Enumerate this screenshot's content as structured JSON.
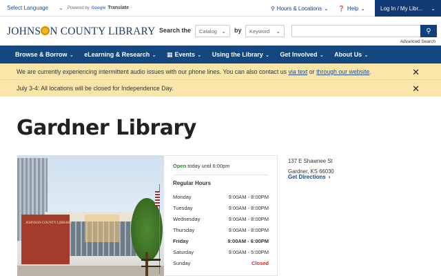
{
  "util": {
    "language_label": "Select Language",
    "powered_by": "Powered by",
    "google": "Google",
    "translate": "Translate",
    "hours_locations": "Hours & Locations",
    "help": "Help",
    "login": "Log In / My Libr..."
  },
  "header": {
    "logo_left": "JOHNS",
    "logo_right": "N COUNTY LIBRARY",
    "search_label": "Search the",
    "catalog_select": "Catalog",
    "by_label": "by",
    "keyword_select": "Keyword",
    "search_value": "",
    "advanced_search": "Advanced Search"
  },
  "nav": {
    "items": [
      {
        "label": "Browse & Borrow"
      },
      {
        "label": "eLearning & Research"
      },
      {
        "label": "Events"
      },
      {
        "label": "Using the Library"
      },
      {
        "label": "Get Involved"
      },
      {
        "label": "About Us"
      }
    ]
  },
  "alerts": {
    "alert1_pre": "We are currently experiencing intermittent audio issues with our phone lines. You can also contact us ",
    "alert1_link1": "via text",
    "alert1_mid": " or ",
    "alert1_link2": "through our website",
    "alert1_post": ".",
    "alert2_text": "July 3-4: All locations will be closed for Independence Day."
  },
  "page": {
    "title": "Gardner Library",
    "photo_sign": "JOHNSON COUNTY LIBRARY"
  },
  "hours": {
    "status": "Open",
    "status_rest": " today until 6:00pm",
    "title": "Regular Hours",
    "days": [
      {
        "day": "Monday",
        "time": "9:00AM - 8:00PM"
      },
      {
        "day": "Tuesday",
        "time": "9:00AM - 8:00PM"
      },
      {
        "day": "Wednesday",
        "time": "9:00AM - 8:00PM"
      },
      {
        "day": "Thursday",
        "time": "9:00AM - 8:00PM"
      },
      {
        "day": "Friday",
        "time": "9:00AM - 6:00PM"
      },
      {
        "day": "Saturday",
        "time": "9:00AM - 5:00PM"
      },
      {
        "day": "Sunday",
        "time": "Closed"
      }
    ]
  },
  "address": {
    "line1": "137 E Shawnee St",
    "line2": "Gardner, KS 66030",
    "directions": "Get Directions"
  },
  "colors": {
    "nav_bg": "#14467f",
    "alert_bg": "#fbe6a9",
    "open_green": "#2e7d32",
    "closed_red": "#c62828"
  }
}
